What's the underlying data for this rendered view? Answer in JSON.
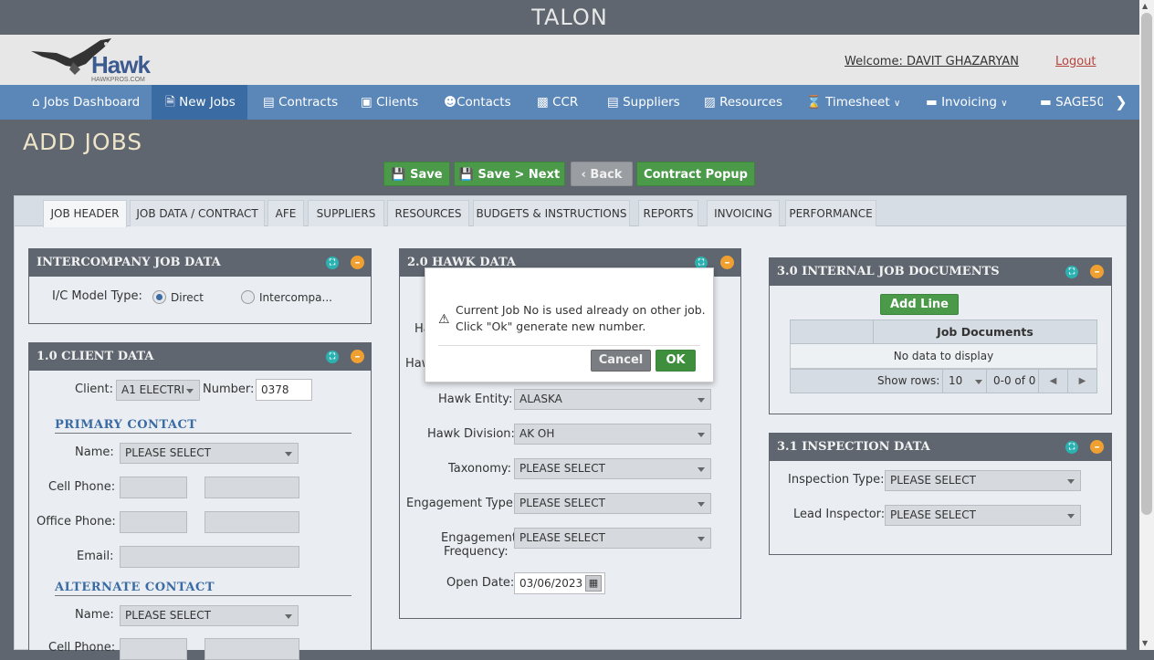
{
  "app": {
    "title": "TALON"
  },
  "header": {
    "welcome": "Welcome: DAVIT GHAZARYAN",
    "logout": "Logout",
    "logo_text": "Hawk",
    "logo_sub": "HAWKPROS.COM"
  },
  "nav": {
    "items": [
      {
        "label": "Jobs Dashboard",
        "icon": "home-icon"
      },
      {
        "label": "New Jobs",
        "icon": "file-icon"
      },
      {
        "label": "Contracts",
        "icon": "document-icon"
      },
      {
        "label": "Clients",
        "icon": "briefcase-icon"
      },
      {
        "label": "Contacts",
        "icon": "users-icon"
      },
      {
        "label": "CCR",
        "icon": "id-card-icon"
      },
      {
        "label": "Suppliers",
        "icon": "archive-icon"
      },
      {
        "label": "Resources",
        "icon": "address-book-icon"
      },
      {
        "label": "Timesheet",
        "icon": "hourglass-icon"
      },
      {
        "label": "Invoicing",
        "icon": "credit-card-icon"
      },
      {
        "label": "SAGE50",
        "icon": "credit-card-icon"
      }
    ]
  },
  "page": {
    "title": "ADD JOBS"
  },
  "toolbar": {
    "save": "Save",
    "save_next": "Save > Next",
    "back": "Back",
    "contract_popup": "Contract Popup"
  },
  "tabs": [
    "JOB HEADER",
    "JOB DATA / CONTRACT",
    "AFE",
    "SUPPLIERS",
    "RESOURCES",
    "BUDGETS & INSTRUCTIONS",
    "REPORTS",
    "INVOICING",
    "PERFORMANCE"
  ],
  "intercompany": {
    "title": "INTERCOMPANY JOB DATA",
    "model_label": "I/C Model Type:",
    "opt_direct": "Direct",
    "opt_inter": "Intercompa..."
  },
  "client": {
    "title": "1.0 CLIENT DATA",
    "client_label": "Client:",
    "client_value": "A1 ELECTRI",
    "number_label": "Number:",
    "number_value": "0378",
    "primary_title": "PRIMARY CONTACT",
    "name_label": "Name:",
    "name_value": "PLEASE SELECT",
    "cell_label": "Cell Phone:",
    "office_label": "Office Phone:",
    "email_label": "Email:",
    "alternate_title": "ALTERNATE CONTACT",
    "alt_name_label": "Name:",
    "alt_name_value": "PLEASE SELECT",
    "alt_cell_label": "Cell Phone:"
  },
  "hawk": {
    "title": "2.0 HAWK DATA",
    "partial1": "Ha",
    "partial2": "Haw",
    "entity_label": "Hawk Entity:",
    "entity_value": "ALASKA",
    "division_label": "Hawk Division:",
    "division_value": "AK OH",
    "taxonomy_label": "Taxonomy:",
    "taxonomy_value": "PLEASE SELECT",
    "etype_label": "Engagement Type:",
    "etype_value": "PLEASE SELECT",
    "efreq_label1": "Engagement",
    "efreq_label2": "Frequency:",
    "efreq_value": "PLEASE SELECT",
    "open_label": "Open Date:",
    "open_value": "03/06/2023"
  },
  "docs": {
    "title": "3.0 INTERNAL JOB DOCUMENTS",
    "add_line": "Add Line",
    "col_header": "Job Documents",
    "empty": "No data to display",
    "show_rows": "Show rows:",
    "rows_value": "10",
    "range": "0-0 of 0"
  },
  "inspection": {
    "title": "3.1 INSPECTION DATA",
    "type_label": "Inspection Type:",
    "type_value": "PLEASE SELECT",
    "lead_label": "Lead Inspector:",
    "lead_value": "PLEASE SELECT"
  },
  "modal": {
    "line1": "Current Job No is used already on other job.",
    "line2": "Click \"Ok\" generate new number.",
    "cancel": "Cancel",
    "ok": "OK"
  }
}
